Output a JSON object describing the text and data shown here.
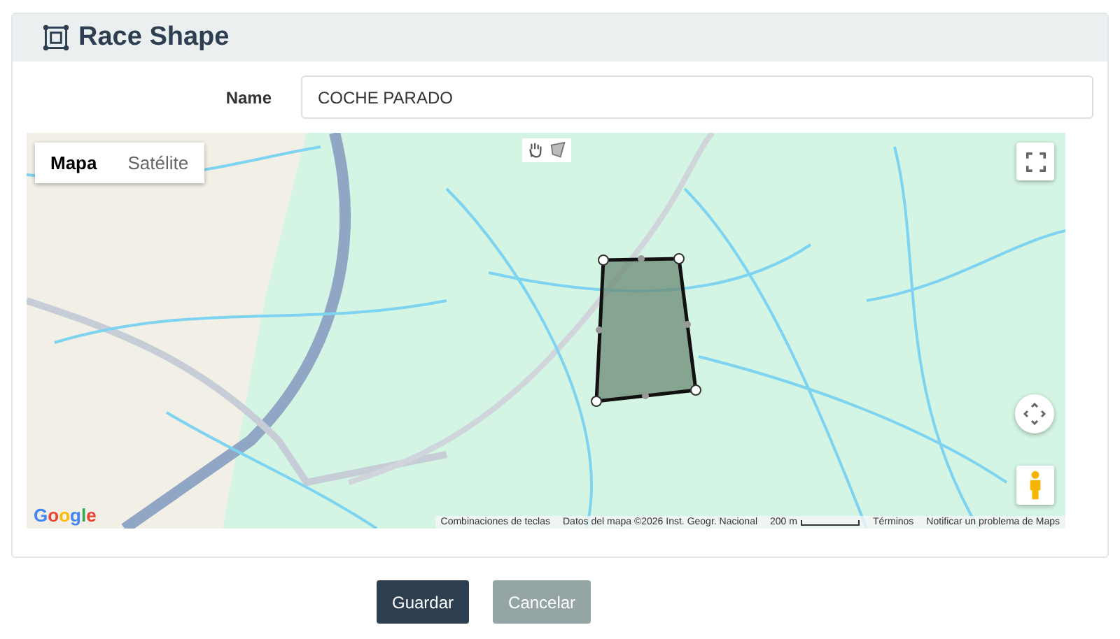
{
  "header": {
    "title": "Race Shape"
  },
  "name_field": {
    "label": "Name",
    "value": "COCHE PARADO"
  },
  "map": {
    "map_types": [
      {
        "label": "Mapa",
        "selected": true
      },
      {
        "label": "Satélite",
        "selected": false
      }
    ],
    "logo": "Google",
    "attribution": [
      {
        "kind": "text",
        "text": "Combinaciones de teclas"
      },
      {
        "kind": "text",
        "text": "Datos del mapa ©2026 Inst. Geogr. Nacional"
      },
      {
        "kind": "scale",
        "text": "200 m"
      },
      {
        "kind": "link",
        "text": "Términos"
      },
      {
        "kind": "link",
        "text": "Notificar un problema de Maps"
      }
    ]
  },
  "buttons": [
    {
      "label": "Guardar",
      "kind": "primary"
    },
    {
      "label": "Cancelar",
      "kind": "secondary"
    }
  ]
}
